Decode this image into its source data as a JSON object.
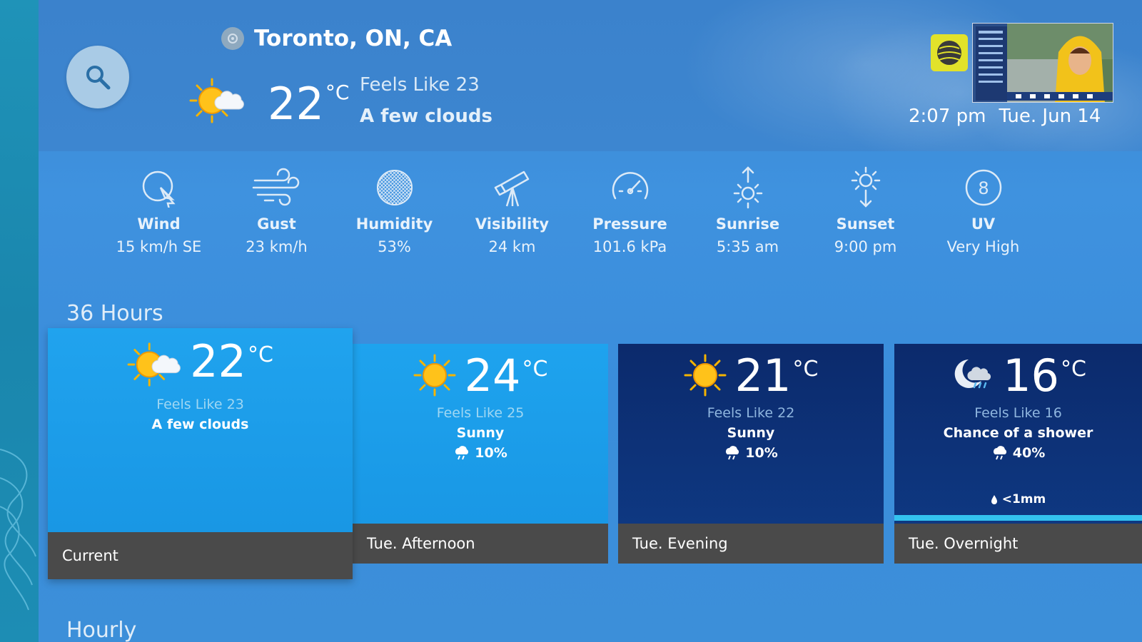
{
  "header": {
    "location": "Toronto, ON, CA",
    "current_temp": "22",
    "unit": "°C",
    "feels_like": "Feels Like 23",
    "condition": "A few clouds",
    "time": "2:07 pm",
    "date": "Tue. Jun 14"
  },
  "metrics": [
    {
      "label": "Wind",
      "value": "15 km/h SE",
      "icon": "wind-icon"
    },
    {
      "label": "Gust",
      "value": "23 km/h",
      "icon": "gust-icon"
    },
    {
      "label": "Humidity",
      "value": "53%",
      "icon": "humidity-icon"
    },
    {
      "label": "Visibility",
      "value": "24 km",
      "icon": "telescope-icon"
    },
    {
      "label": "Pressure",
      "value": "101.6 kPa",
      "icon": "gauge-icon"
    },
    {
      "label": "Sunrise",
      "value": "5:35 am",
      "icon": "sunrise-icon"
    },
    {
      "label": "Sunset",
      "value": "9:00 pm",
      "icon": "sunset-icon"
    },
    {
      "label": "UV",
      "value": "Very High",
      "icon": "uv-icon",
      "badge": "8"
    }
  ],
  "sections": {
    "hours36": "36 Hours",
    "hourly": "Hourly"
  },
  "forecast": [
    {
      "period": "Current",
      "temp": "22",
      "unit": "°C",
      "feels": "Feels Like  23",
      "cond": "A few clouds",
      "pop": "",
      "icon": "sun-cloud-icon"
    },
    {
      "period": "Tue. Afternoon",
      "temp": "24",
      "unit": "°C",
      "feels": "Feels Like  25",
      "cond": "Sunny",
      "pop": "10%",
      "icon": "sun-icon"
    },
    {
      "period": "Tue. Evening",
      "temp": "21",
      "unit": "°C",
      "feels": "Feels Like  22",
      "cond": "Sunny",
      "pop": "10%",
      "icon": "sun-icon"
    },
    {
      "period": "Tue. Overnight",
      "temp": "16",
      "unit": "°C",
      "feels": "Feels Like  16",
      "cond": "Chance of a shower",
      "pop": "40%",
      "precip": "<1mm",
      "icon": "moon-shower-icon"
    }
  ],
  "colors": {
    "background": "#3c8fd9",
    "card_current": "#1a9ae6",
    "card_afternoon": "#17a0ea",
    "card_dark": "#0c2f72",
    "footer": "#4a4a4a",
    "accent_bar": "#33c3ef"
  }
}
